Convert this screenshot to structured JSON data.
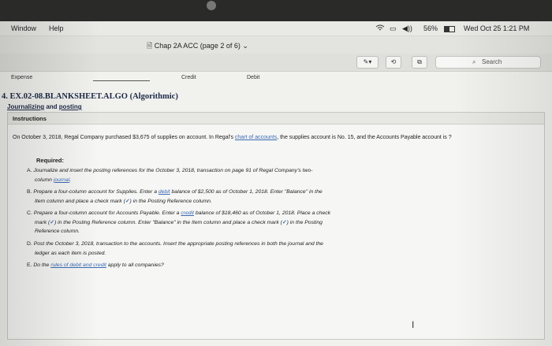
{
  "menubar": {
    "items": [
      "Window",
      "Help"
    ],
    "battery": "56%",
    "datetime": "Wed Oct 25  1:21 PM"
  },
  "window": {
    "title": "Chap 2A ACC (page 2 of 6)"
  },
  "toolbar": {
    "search_placeholder": "Search"
  },
  "header_strip": {
    "expense": "Expense",
    "credit": "Credit",
    "debit": "Debit"
  },
  "question": {
    "title": "4. EX.02-08.BLANKSHEET.ALGO (Algorithmic)",
    "subtitle_a": "Journalizing",
    "subtitle_b": " and ",
    "subtitle_c": "posting",
    "panel_heading": "Instructions",
    "intro_a": "On October 3, 2018, Regal Company purchased $3,675 of supplies on account. In Regal's ",
    "intro_link": "chart of accounts",
    "intro_b": ", the supplies account is No. 15, and the Accounts Payable account is ?",
    "required": "Required:",
    "items": [
      {
        "letter": "A.",
        "line1": "Journalize and insert the posting references for the October 3, 2018, transaction on page 91 of Regal Company's two-",
        "line2_pre": "column ",
        "line2_link": "journal",
        "line2_post": "."
      },
      {
        "letter": "B.",
        "line1_pre": "Prepare a four-column account for Supplies. Enter a ",
        "line1_link": "debit",
        "line1_post": " balance of $2,500 as of October 1, 2018. Enter \"Balance\" in the",
        "line2_pre": "Item column and place a check mark (",
        "check": "✓",
        "line2_post": ") in the Posting Reference column."
      },
      {
        "letter": "C.",
        "line1_pre": "Prepare a four-column account for Accounts Payable. Enter a ",
        "line1_link": "credit",
        "line1_post": " balance of $18,460 as of October 1, 2018. Place a check",
        "line2_pre": "mark (",
        "check": "✓",
        "line2_post": ") in the Posting Reference column. Enter \"Balance\" in the Item column and place a check mark (",
        "line2_end": ") in the Posting",
        "line3": "Reference column."
      },
      {
        "letter": "D.",
        "line1": "Post the October 3, 2018, transaction to the accounts. Insert the appropriate posting references in both the journal and the",
        "line2": "ledger as each item is posted."
      },
      {
        "letter": "E.",
        "line1_pre": "Do the ",
        "line1_link": "rules of debit and credit",
        "line1_post": " apply to all companies?"
      }
    ]
  }
}
